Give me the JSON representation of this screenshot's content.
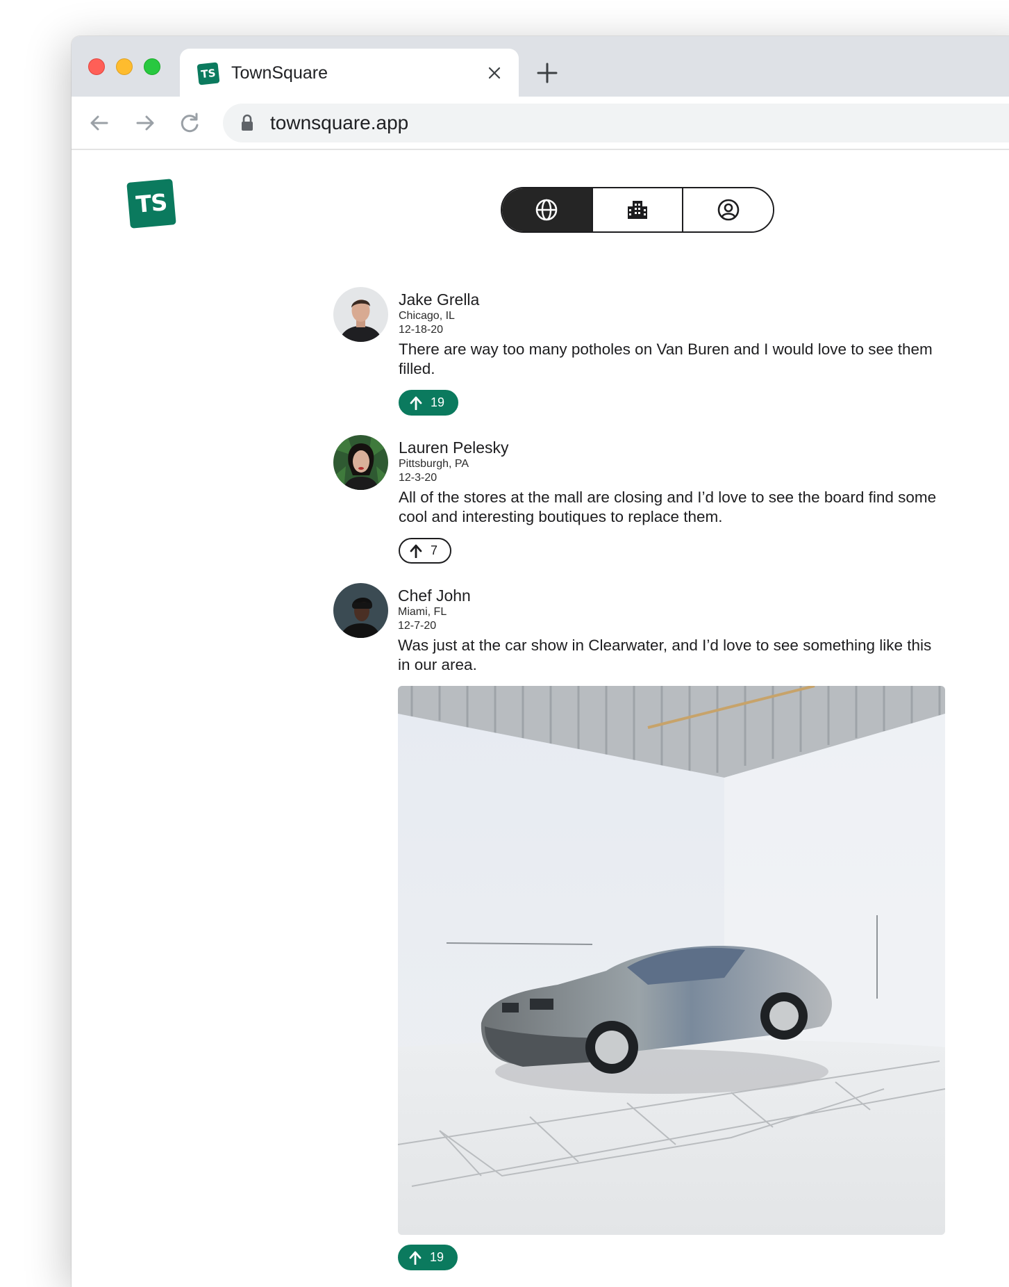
{
  "browser": {
    "tab_title": "TownSquare",
    "tab_favicon_text": "TS",
    "url": "townsquare.app"
  },
  "app": {
    "logo_text": "TS",
    "brand_color": "#0b7a5e",
    "nav": [
      {
        "name": "global",
        "icon": "globe-icon",
        "active": true
      },
      {
        "name": "city",
        "icon": "building-icon",
        "active": false
      },
      {
        "name": "profile",
        "icon": "user-circle-icon",
        "active": false
      }
    ]
  },
  "posts": [
    {
      "author": "Jake Grella",
      "location": "Chicago, IL",
      "date": "12-18-20",
      "content": "There are way too many potholes on Van Buren and I would love to see them filled.",
      "upvotes": "19",
      "upvoted": true
    },
    {
      "author": "Lauren Pelesky",
      "location": "Pittsburgh, PA",
      "date": "12-3-20",
      "content": "All of the stores at the mall are closing and I’d love to see the board find some cool and interesting boutiques to replace them.",
      "upvotes": "7",
      "upvoted": false
    },
    {
      "author": "Chef John",
      "location": "Miami, FL",
      "date": "12-7-20",
      "content": "Was just at the car show in Clearwater, and I’d love to see something like this in our area.",
      "upvotes": "19",
      "upvoted": true,
      "image": "sports-car-in-white-studio-photo"
    }
  ]
}
